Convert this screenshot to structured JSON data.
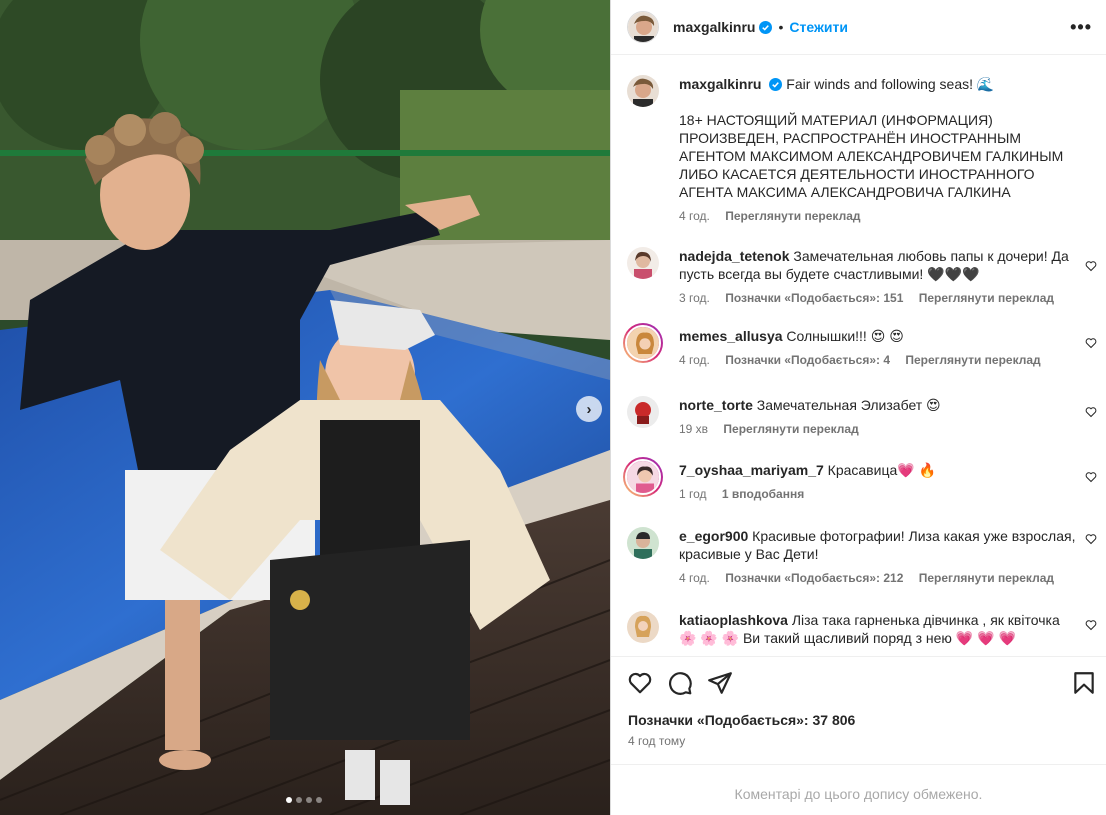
{
  "post": {
    "username": "maxgalkinru",
    "follow_label": "Стежити",
    "dot": "•",
    "more_label": "•••",
    "next_arrow": "›",
    "caption_line1": "Fair winds and following seas! 🌊",
    "caption_body": "18+ НАСТОЯЩИЙ МАТЕРИАЛ (ИНФОРМАЦИЯ) ПРОИЗВЕДЕН, РАСПРОСТРАНЁН ИНОСТРАННЫМ АГЕНТОМ МАКСИМОМ АЛЕКСАНДРОВИЧЕМ ГАЛКИНЫМ ЛИБО КАСАЕТСЯ ДЕЯТЕЛЬНОСТИ ИНОСТРАННОГО АГЕНТА МАКСИМА АЛЕКСАНДРОВИЧА ГАЛКИНА",
    "caption_time": "4 год.",
    "caption_translate": "Переглянути переклад",
    "likes": "Позначки «Подобається»: 37 806",
    "time_ago": "4 год тому",
    "comments_limited": "Коментарі до цього допису обмежено."
  },
  "comments": [
    {
      "user": "nadejda_tetenok",
      "text": "Замечательная любовь папы к дочери! Да пусть всегда вы будете счастливыми! 🖤🖤🖤",
      "time": "3 год.",
      "likes": "Позначки «Подобається»: 151",
      "translate": "Переглянути переклад"
    },
    {
      "user": "memes_allusya",
      "text": "Солнышки!!! 😍 😍",
      "time": "4 год.",
      "likes": "Позначки «Подобається»: 4",
      "translate": "Переглянути переклад"
    },
    {
      "user": "norte_torte",
      "text": "Замечательная Элизабет 😍",
      "time": "19 хв",
      "translate": "Переглянути переклад"
    },
    {
      "user": "7_oyshaa_mariyam_7",
      "text": "Красавица💗 🔥",
      "time": "1 год",
      "likes": "1 вподобання"
    },
    {
      "user": "e_egor900",
      "text": "Красивые фотографии! Лиза какая уже взрослая, красивые у Вас Дети!",
      "time": "4 год.",
      "likes": "Позначки «Подобається»: 212",
      "translate": "Переглянути переклад"
    },
    {
      "user": "katiaoplashkova",
      "text": "Ліза така гарненька дівчинка , як квіточка 🌸 🌸 🌸 Ви такий щасливий поряд з нею 💗 💗 💗"
    }
  ],
  "carousel": {
    "count": 4,
    "active": 1
  },
  "colors": {
    "accent": "#0095f6",
    "muted": "#737373",
    "border": "#dbdbdb"
  },
  "icons": [
    "verified-badge-icon",
    "more-options-icon",
    "heart-icon",
    "comment-icon",
    "share-icon",
    "bookmark-icon",
    "chevron-right-icon"
  ]
}
